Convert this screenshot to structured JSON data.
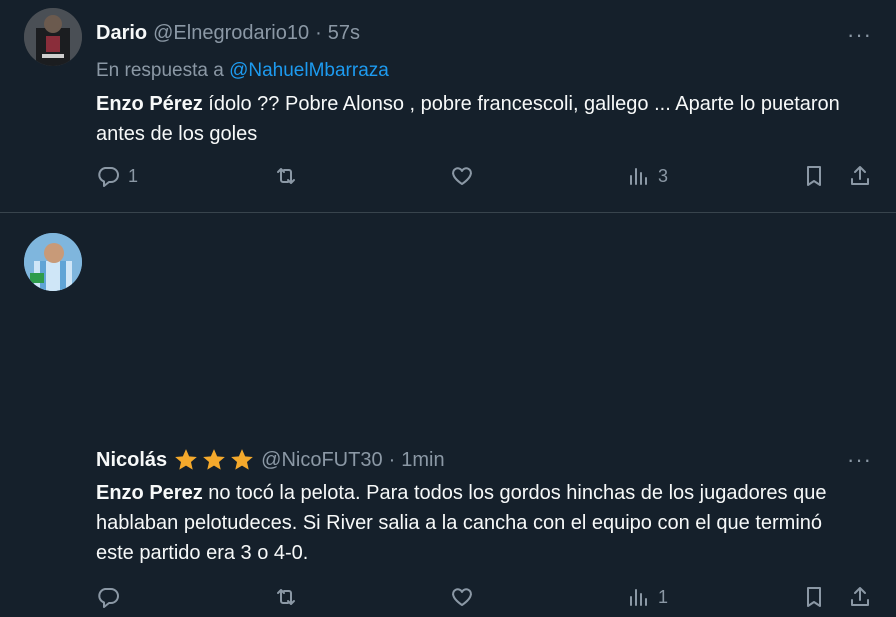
{
  "tweets": [
    {
      "name": "Dario",
      "handle": "@Elnegrodario10",
      "separator": "·",
      "time": "57s",
      "reply_prefix": "En respuesta a ",
      "reply_mention": "@NahuelMbarraza",
      "bold_lead": "Enzo Pérez",
      "text_rest": " ídolo ?? Pobre Alonso , pobre francescoli, gallego ... Aparte lo puetaron antes de los goles",
      "reply_count": "1",
      "retweet_count": "",
      "like_count": "",
      "views_count": "3",
      "more": "···"
    },
    {
      "name": "Nicolás",
      "handle": "@NicoFUT30",
      "separator": "·",
      "time": "1min",
      "star_color": "#f4a92c",
      "bold_lead": "Enzo Perez",
      "text_rest": " no tocó la pelota. Para todos los gordos hinchas de los jugadores que hablaban pelotudeces. Si River salia a la cancha con el equipo con el que terminó este partido era 3 o 4-0.",
      "reply_count": "",
      "retweet_count": "",
      "like_count": "",
      "views_count": "1",
      "more": "···"
    }
  ],
  "icons": [
    "reply-icon",
    "retweet-icon",
    "like-icon",
    "views-icon",
    "bookmark-icon",
    "share-icon",
    "more-icon",
    "star-icon"
  ]
}
